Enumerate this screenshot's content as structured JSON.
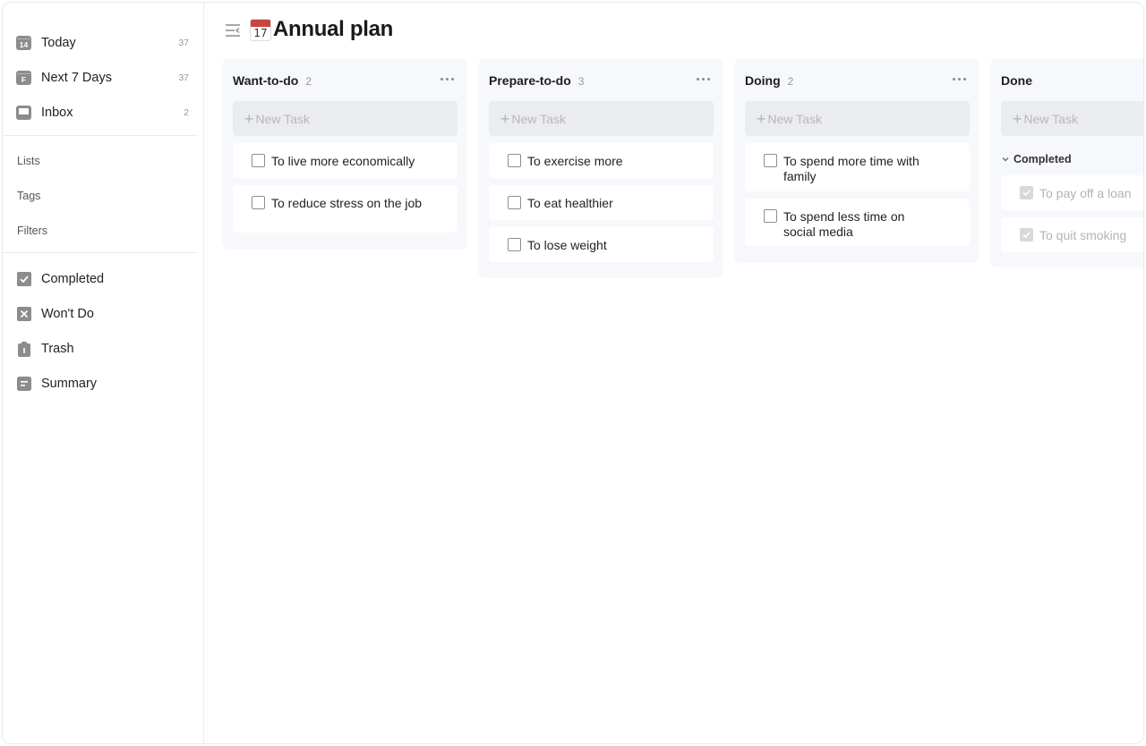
{
  "sidebar": {
    "smart_lists": [
      {
        "label": "Today",
        "count": "37",
        "icon": "14"
      },
      {
        "label": "Next 7 Days",
        "count": "37",
        "icon": "F"
      },
      {
        "label": "Inbox",
        "count": "2",
        "icon": "inbox"
      }
    ],
    "sections": {
      "lists": "Lists",
      "tags": "Tags",
      "filters": "Filters"
    },
    "bottom": [
      {
        "label": "Completed",
        "icon": "check-box-icon"
      },
      {
        "label": "Won't Do",
        "icon": "x-box-icon"
      },
      {
        "label": "Trash",
        "icon": "trash-icon"
      },
      {
        "label": "Summary",
        "icon": "summary-icon"
      }
    ]
  },
  "header": {
    "emoji_day": "17",
    "title": "Annual plan"
  },
  "board": {
    "new_task_placeholder": "New Task",
    "columns": [
      {
        "title": "Want-to-do",
        "count": "2",
        "tasks": [
          "To live more economically",
          "To reduce stress on the job"
        ]
      },
      {
        "title": "Prepare-to-do",
        "count": "3",
        "tasks": [
          "To exercise more",
          "To eat healthier",
          "To lose weight"
        ]
      },
      {
        "title": "Doing",
        "count": "2",
        "tasks": [
          "To spend more time with family",
          "To spend less time on social media"
        ]
      },
      {
        "title": "Done",
        "count": "",
        "completed_label": "Completed",
        "completed_tasks": [
          "To pay off a loan",
          "To quit smoking"
        ]
      }
    ]
  },
  "colors": {
    "accent_gray": "#8c8c8c",
    "column_bg": "#f7f8fb",
    "new_task_bg": "#ebecef",
    "calendar_red": "#c9443b"
  }
}
